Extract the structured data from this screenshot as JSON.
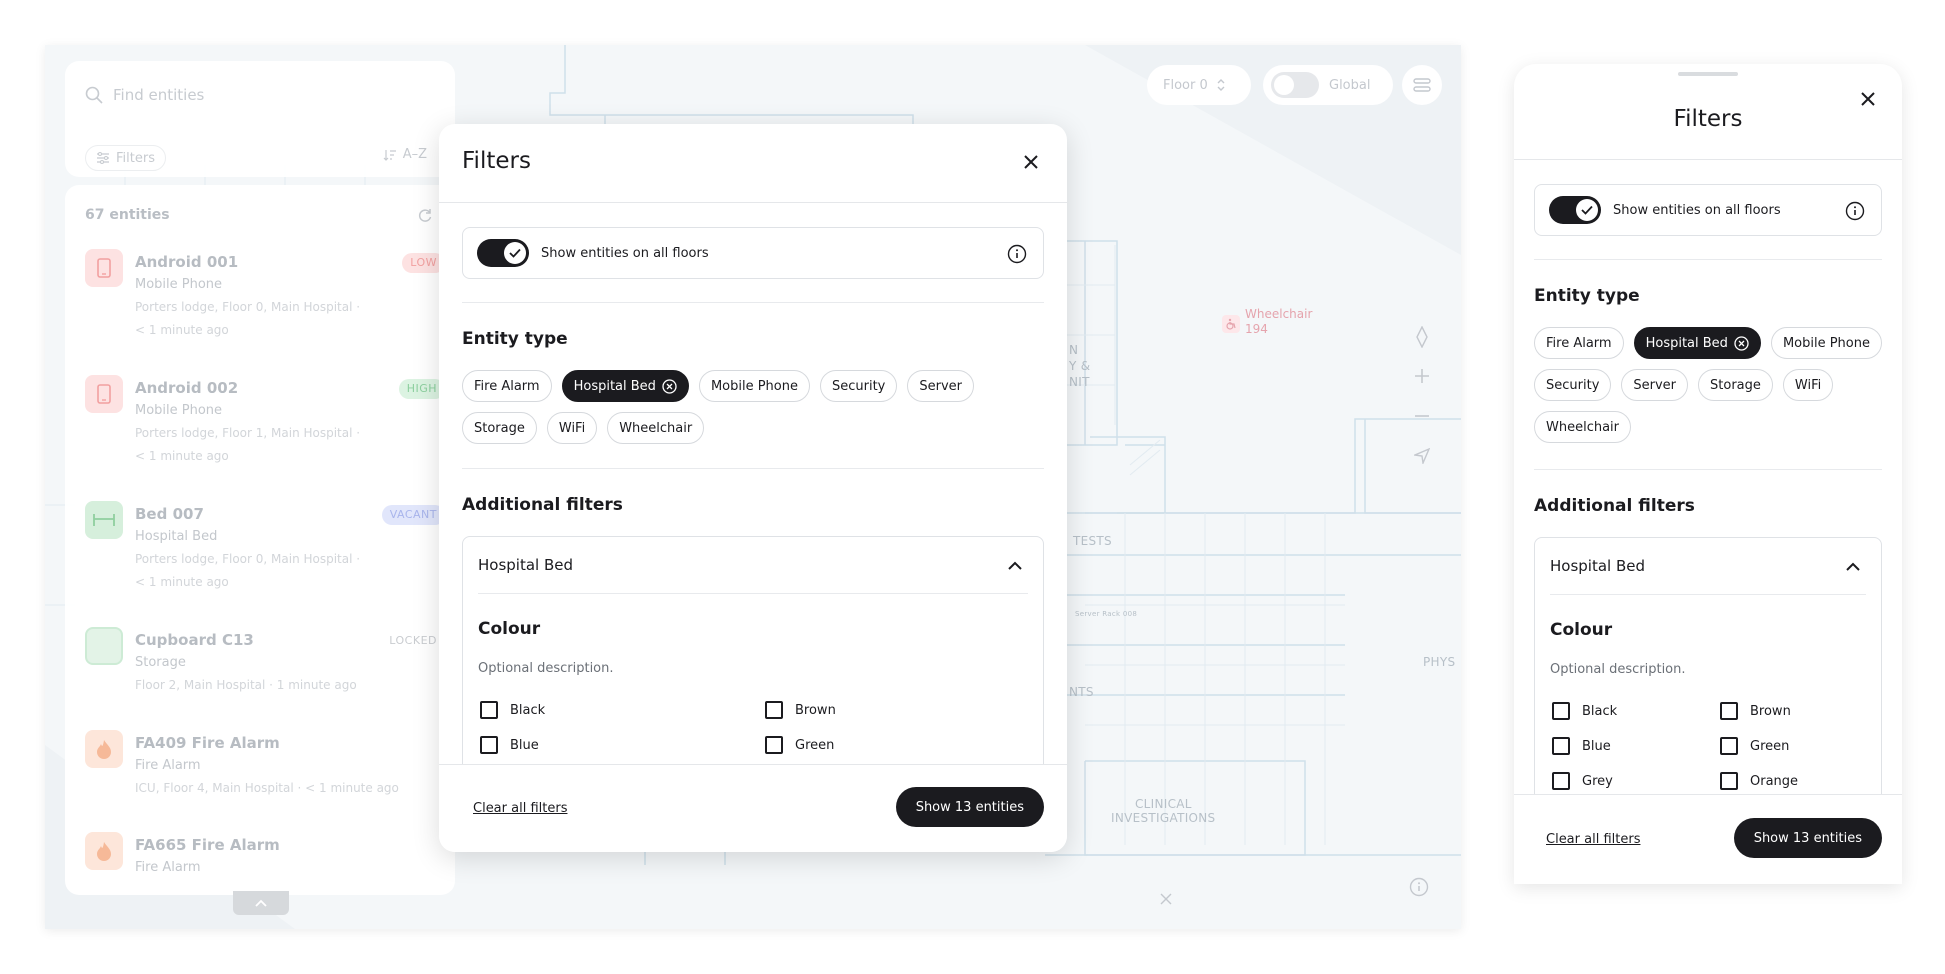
{
  "map": {
    "floor_label": "Floor 0",
    "global_label": "Global",
    "wheelchair_pin_label": "Wheelchair 194",
    "labels": [
      "Y &",
      "NIT",
      "N",
      "TESTS",
      "NTS",
      "PHYS",
      "CLINICAL",
      "INVESTIGATIONS",
      "Server Rack 008"
    ]
  },
  "left_panel": {
    "search_placeholder": "Find entities",
    "filters_label": "Filters",
    "sort_label": "A–Z",
    "count_label": "67 entities",
    "entities": [
      {
        "title": "Android 001",
        "type": "Mobile Phone",
        "location": "Porters lodge, Floor 0, Main Hospital ·",
        "time": "< 1 minute ago",
        "badge": "LOW",
        "badge_color": "#fde2e2",
        "badge_text_color": "#f2a0a0",
        "icon": "phone-icon",
        "icon_bg": "#fde2e2"
      },
      {
        "title": "Android 002",
        "type": "Mobile Phone",
        "location": "Porters lodge, Floor 1, Main Hospital ·",
        "time": "< 1 minute ago",
        "badge": "HIGH",
        "badge_color": "#dcf3e2",
        "badge_text_color": "#8ccf9e",
        "icon": "phone-icon",
        "icon_bg": "#fde2e2"
      },
      {
        "title": "Bed 007",
        "type": "Hospital Bed",
        "location": "Porters lodge, Floor 0, Main Hospital ·",
        "time": "< 1 minute ago",
        "badge": "VACANT",
        "badge_color": "#e1e6fb",
        "badge_text_color": "#a9b5ec",
        "icon": "bed-icon",
        "icon_bg": "#d6efdc"
      },
      {
        "title": "Cupboard C13",
        "type": "Storage",
        "location": "Floor 2, Main Hospital · 1 minute ago",
        "time": "",
        "badge": "LOCKED",
        "badge_color": "#ffffff",
        "badge_text_color": "#c9ccd0",
        "icon": "storage-icon",
        "icon_bg": "#e3f3e7"
      },
      {
        "title": "FA409 Fire Alarm",
        "type": "Fire Alarm",
        "location": "ICU, Floor 4, Main Hospital · < 1 minute ago",
        "time": "",
        "badge": "",
        "badge_color": "#ffffff",
        "badge_text_color": "#ffffff",
        "icon": "flame-icon",
        "icon_bg": "#fde6da"
      },
      {
        "title": "FA665 Fire Alarm",
        "type": "Fire Alarm",
        "location": "",
        "time": "",
        "badge": "",
        "badge_color": "#ffffff",
        "badge_text_color": "#ffffff",
        "icon": "flame-icon",
        "icon_bg": "#fde6da"
      }
    ]
  },
  "dialog": {
    "title": "Filters",
    "toggle_label": "Show entities on all floors",
    "entity_type_title": "Entity type",
    "entity_types": [
      {
        "label": "Fire Alarm",
        "selected": false
      },
      {
        "label": "Hospital Bed",
        "selected": true
      },
      {
        "label": "Mobile Phone",
        "selected": false
      },
      {
        "label": "Security",
        "selected": false
      },
      {
        "label": "Server",
        "selected": false
      },
      {
        "label": "Storage",
        "selected": false
      },
      {
        "label": "WiFi",
        "selected": false
      },
      {
        "label": "Wheelchair",
        "selected": false
      }
    ],
    "additional_filters_title": "Additional filters",
    "accordion_title": "Hospital Bed",
    "colour_title": "Colour",
    "colour_description": "Optional description.",
    "colours_desktop": [
      "Black",
      "Brown",
      "Blue",
      "Green"
    ],
    "colours_mobile": [
      "Black",
      "Brown",
      "Blue",
      "Green",
      "Grey",
      "Orange"
    ],
    "clear_label": "Clear all filters",
    "show_label": "Show 13 entities"
  },
  "colors": {
    "primary": "#1b1b1f",
    "map_bg": "#f4f7f9",
    "map_line": "#cfe0ea"
  }
}
